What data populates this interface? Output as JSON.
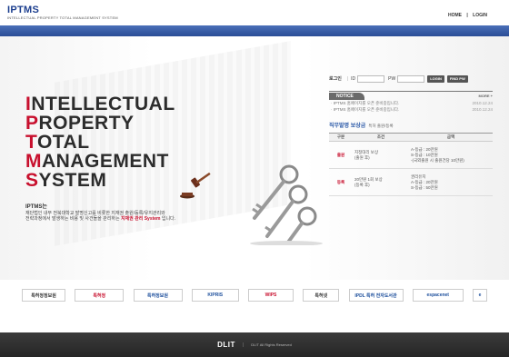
{
  "header": {
    "logo": "IPTMS",
    "logo_sub": "INTELLECTUAL PROPERTY TOTAL MANAGEMENT SYSTEM",
    "links": [
      "HOME",
      "|",
      "LOGIN"
    ]
  },
  "hero": {
    "title_lines": [
      {
        "cap": "I",
        "rest": "NTELLECTUAL"
      },
      {
        "cap": "P",
        "rest": "ROPERTY"
      },
      {
        "cap": "T",
        "rest": "OTAL"
      },
      {
        "cap": "M",
        "rest": "ANAGEMENT"
      },
      {
        "cap": "S",
        "rest": "YSTEM"
      }
    ],
    "desc_title": "IPTMS는",
    "desc_line1": "재단법인 내부 전북대학교 발명신고를 비롯한 지재권 출원/등록/유지관리와",
    "desc_line2_pre": "전략과정에서 발생하는 비용 및 사건들을 관리하는 ",
    "desc_em": "지재권 관리 System",
    "desc_line2_post": " 입니다."
  },
  "login": {
    "label": "로그인",
    "id_label": "ID",
    "pw_label": "PW",
    "login_btn": "LOGIN",
    "find_btn": "FIND PW"
  },
  "notice": {
    "tab": "NOTICE",
    "more": "MORE +",
    "items": [
      {
        "text": "· IPTMS 홈페이지를 오픈 준비중입니다.",
        "date": "2010.12.24"
      },
      {
        "text": "· IPTMS 홈페이지를 오픈 준비중입니다.",
        "date": "2010.12.24"
      }
    ]
  },
  "compensation": {
    "title": "직무발명 보상금",
    "subtitle": "특허 출원/등록",
    "headers": [
      "구분",
      "조건",
      "금액"
    ],
    "rows": [
      {
        "cat": "출원",
        "cond": "지정대리 보상\n(출원 후)",
        "amount": "A-등급 : 20만원\nS-등급 : 10만원\n-(국외출원 시 출원건당 10만원)"
      },
      {
        "cat": "등록",
        "cond": "20만원 1회 보상\n(등록 후)",
        "amount": "권리유지\nA-등급 : 20만원\nS-등급 : 50만원"
      }
    ]
  },
  "partners": [
    "특허청정보원",
    "특허청",
    "특허정보원",
    "KIPRIS",
    "WIPS",
    "특허넷",
    "IPDL 특허 전자도서관",
    "espacenet",
    "e"
  ],
  "footer": {
    "logo": "DLIT",
    "sep": "|",
    "copyright": "DLIT All Rights Reserved"
  },
  "colors": {
    "brand_blue": "#2a4d96",
    "accent_red": "#c8102e",
    "footer": "#2b2b2b"
  }
}
